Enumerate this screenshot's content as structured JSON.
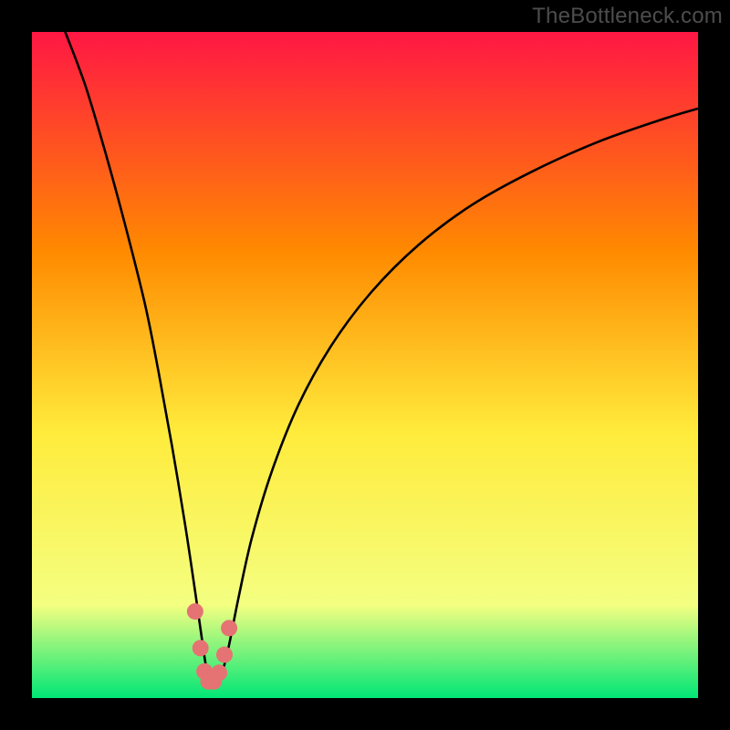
{
  "watermark": "TheBottleneck.com",
  "chart_data": {
    "type": "line",
    "title": "",
    "xlabel": "",
    "ylabel": "",
    "xlim": [
      0,
      100
    ],
    "ylim": [
      0,
      100
    ],
    "background_gradient": {
      "top": "#ff1744",
      "mid_upper": "#ff8a00",
      "mid": "#ffeb3b",
      "lower": "#f4ff81",
      "bottom": "#00e676"
    },
    "series": [
      {
        "name": "bottleneck-curve",
        "color": "#000000",
        "x": [
          5.0,
          8.0,
          11.0,
          14.0,
          17.0,
          19.0,
          21.0,
          23.0,
          24.5,
          25.5,
          26.2,
          27.0,
          27.8,
          28.6,
          29.6,
          31.0,
          33.0,
          36.0,
          40.0,
          45.0,
          51.0,
          58.0,
          66.0,
          75.0,
          85.0,
          95.0,
          100.0
        ],
        "values": [
          100.0,
          92.0,
          82.0,
          71.0,
          59.0,
          49.0,
          38.0,
          26.0,
          16.0,
          9.0,
          4.5,
          2.5,
          2.5,
          4.0,
          8.0,
          15.0,
          24.0,
          34.0,
          44.0,
          53.0,
          61.0,
          68.0,
          74.0,
          79.0,
          83.5,
          87.0,
          88.5
        ]
      }
    ],
    "markers": {
      "name": "trough-points",
      "color": "#e57373",
      "x": [
        24.5,
        25.3,
        25.9,
        26.5,
        27.3,
        28.1,
        28.9,
        29.6
      ],
      "values": [
        13.0,
        7.5,
        4.0,
        2.5,
        2.5,
        3.8,
        6.5,
        10.5
      ]
    }
  }
}
